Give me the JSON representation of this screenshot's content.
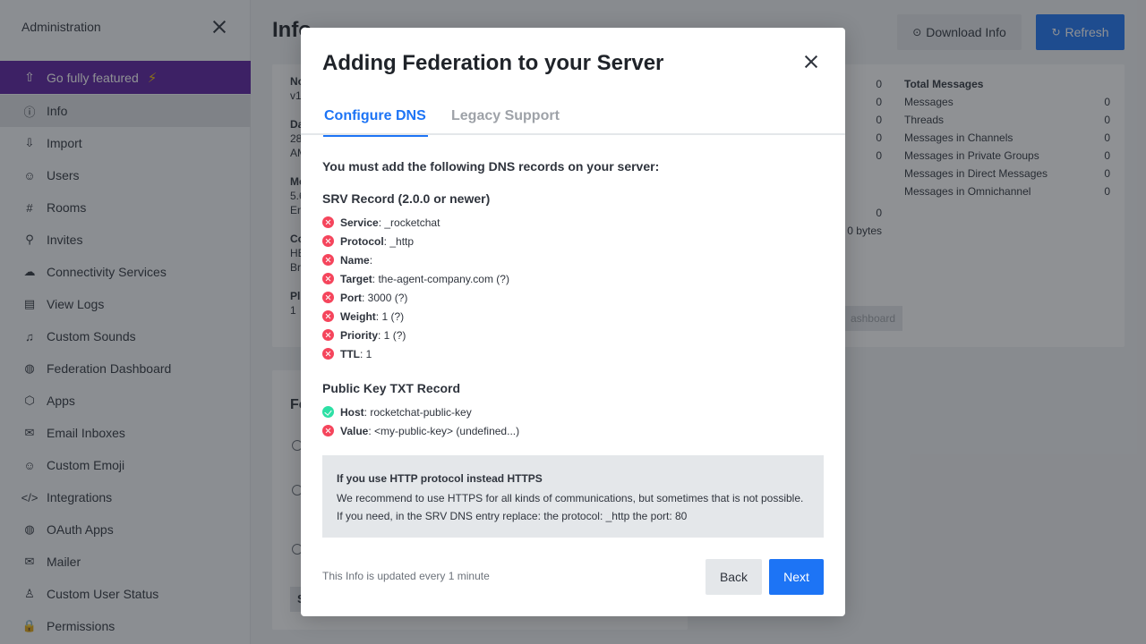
{
  "sidebar": {
    "title": "Administration",
    "feature_label": "Go fully featured",
    "feature_badge": "⚡",
    "items": [
      {
        "label": "Info",
        "icon": "info-icon",
        "glyph": "ⓘ"
      },
      {
        "label": "Import",
        "icon": "import-icon",
        "glyph": "⇩"
      },
      {
        "label": "Users",
        "icon": "users-icon",
        "glyph": "☺"
      },
      {
        "label": "Rooms",
        "icon": "hash-icon",
        "glyph": "#"
      },
      {
        "label": "Invites",
        "icon": "user-plus-icon",
        "glyph": "⚲"
      },
      {
        "label": "Connectivity Services",
        "icon": "cloud-icon",
        "glyph": "☁"
      },
      {
        "label": "View Logs",
        "icon": "file-icon",
        "glyph": "▤"
      },
      {
        "label": "Custom Sounds",
        "icon": "volume-icon",
        "glyph": "♫"
      },
      {
        "label": "Federation Dashboard",
        "icon": "globe-icon",
        "glyph": "◍"
      },
      {
        "label": "Apps",
        "icon": "cube-icon",
        "glyph": "⬡"
      },
      {
        "label": "Email Inboxes",
        "icon": "mail-icon",
        "glyph": "✉"
      },
      {
        "label": "Custom Emoji",
        "icon": "emoji-icon",
        "glyph": "☺"
      },
      {
        "label": "Integrations",
        "icon": "code-icon",
        "glyph": "</>"
      },
      {
        "label": "OAuth Apps",
        "icon": "globe-icon",
        "glyph": "◍"
      },
      {
        "label": "Mailer",
        "icon": "mail-icon",
        "glyph": "✉"
      },
      {
        "label": "Custom User Status",
        "icon": "user-icon",
        "glyph": "♙"
      },
      {
        "label": "Permissions",
        "icon": "lock-icon",
        "glyph": "🔒"
      }
    ]
  },
  "main": {
    "title": "Info",
    "download_label": "Download Info",
    "refresh_label": "Refresh",
    "stats": {
      "title": "Total Messages",
      "rows": [
        {
          "label": "Messages",
          "value": "0"
        },
        {
          "label": "Threads",
          "value": "0"
        },
        {
          "label": "Messages in Channels",
          "value": "0"
        },
        {
          "label": "Messages in Private Groups",
          "value": "0"
        },
        {
          "label": "Messages in Direct Messages",
          "value": "0"
        },
        {
          "label": "Messages in Omnichannel",
          "value": "0"
        }
      ]
    },
    "mid_values": [
      "0",
      "0",
      "0",
      "0",
      "0"
    ],
    "mid_extra": [
      "0",
      "0 bytes"
    ],
    "dashboard_label": "ashboard",
    "fragments": {
      "a": "No",
      "b": "v1",
      "c": "Da",
      "d": "28",
      "e": "AM",
      "f": "Mo",
      "g": "5.6",
      "h": "En",
      "i": "Co",
      "j": "HE",
      "k": "Br",
      "l": "Pl",
      "m": "1"
    },
    "fed_head": "Fe",
    "fed_s": "S"
  },
  "modal": {
    "title": "Adding Federation to your Server",
    "tabs": {
      "active": "Configure DNS",
      "inactive": "Legacy Support"
    },
    "intro": "You must add the following DNS records on your server:",
    "srv_title": "SRV Record (2.0.0 or newer)",
    "srv_records": [
      {
        "key": "Service",
        "value": ": _rocketchat",
        "status": "err"
      },
      {
        "key": "Protocol",
        "value": ": _http",
        "status": "err"
      },
      {
        "key": "Name",
        "value": ":",
        "status": "err"
      },
      {
        "key": "Target",
        "value": ": the-agent-company.com (?)",
        "status": "err"
      },
      {
        "key": "Port",
        "value": ": 3000 (?)",
        "status": "err"
      },
      {
        "key": "Weight",
        "value": ": 1 (?)",
        "status": "err"
      },
      {
        "key": "Priority",
        "value": ": 1 (?)",
        "status": "err"
      },
      {
        "key": "TTL",
        "value": ": 1",
        "status": "err"
      }
    ],
    "txt_title": "Public Key TXT Record",
    "txt_records": [
      {
        "key": "Host",
        "value": ": rocketchat-public-key",
        "status": "ok"
      },
      {
        "key": "Value",
        "value": ": <my-public-key> (undefined...)",
        "status": "err"
      }
    ],
    "note": {
      "title": "If you use HTTP protocol instead HTTPS",
      "line1": "We recommend to use HTTPS for all kinds of communications, but sometimes that is not possible.",
      "line2": "If you need, in the SRV DNS entry replace: the protocol: _http the port: 80"
    },
    "footer": "This Info is updated every 1 minute",
    "back_label": "Back",
    "next_label": "Next"
  },
  "colors": {
    "primary": "#1d74f5",
    "feature": "#5b1fa1",
    "error": "#f5455c",
    "success": "#2de0a5"
  }
}
